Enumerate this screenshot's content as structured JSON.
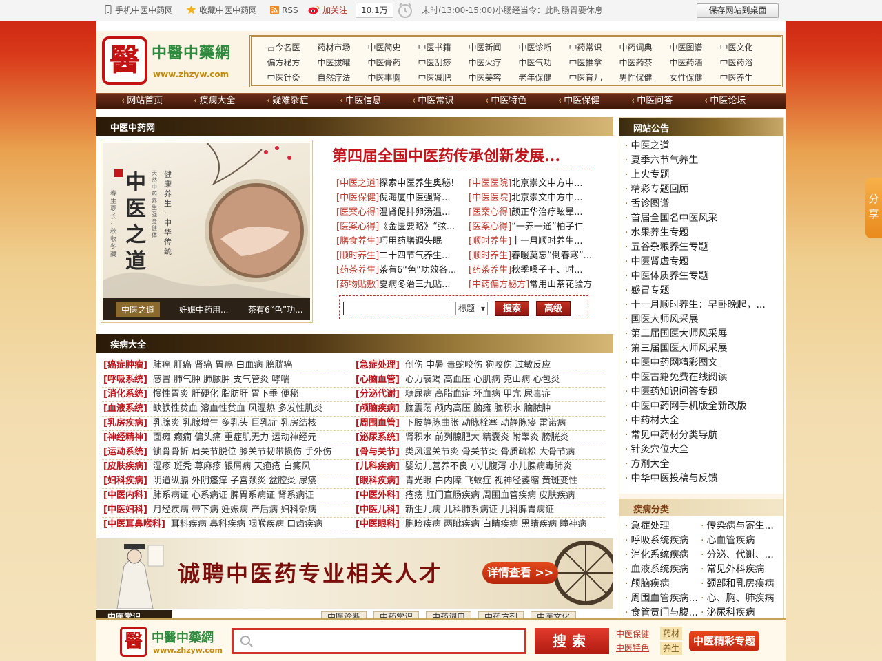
{
  "topbar": {
    "mobile": "手机中医中药网",
    "favorite": "收藏中医中药网",
    "rss": "RSS",
    "follow": "加关注",
    "fans": "10.1万",
    "notice": "未时(13:00-15:00)小肠经当令：此时肠胃要休息",
    "save_desktop": "保存网站到桌面"
  },
  "logo": {
    "seal": "醫",
    "cn": "中醫中藥網",
    "url": "www.zhzyw.com"
  },
  "header_links": [
    "古今名医",
    "药材市场",
    "中医简史",
    "中医书籍",
    "中医新闻",
    "中医诊断",
    "中药常识",
    "中药词典",
    "中医图谱",
    "中医文化",
    "偏方秘方",
    "中医拔罐",
    "中医膏药",
    "中医刮痧",
    "中医火疗",
    "中医气功",
    "中医推拿",
    "中医药茶",
    "中医药酒",
    "中医药浴",
    "中医针灸",
    "自然疗法",
    "中医丰胸",
    "中医减肥",
    "中医美容",
    "老年保健",
    "中医育儿",
    "男性保健",
    "女性保健",
    "中医养生"
  ],
  "nav": [
    "网站首页",
    "疾病大全",
    "疑难杂症",
    "中医信息",
    "中医常识",
    "中医特色",
    "中医保健",
    "中医问答",
    "中医论坛"
  ],
  "sections": {
    "main": "中医中药网",
    "notice": "网站公告",
    "disease": "疾病大全",
    "disease_class": "疾病分类",
    "zy_common": "中医常识"
  },
  "feature": {
    "captions": [
      "中医之道",
      "妊娠中药用...",
      "茶有6“色”功..."
    ],
    "art_title": "中医之道",
    "art_sub1": "健康养生 · 中华传统",
    "art_sub2": "天然中药养生强身健体",
    "art_small": "春生夏长 · 秋收冬藏"
  },
  "headline": "第四届全国中医药传承创新发展...",
  "news": [
    [
      {
        "cat": "[中医之道]",
        "text": "探索中医养生奥秘!"
      },
      {
        "cat": "[中医医院]",
        "text": "北京崇文中方中..."
      }
    ],
    [
      {
        "cat": "[中医保健]",
        "text": "倪海厦中医强肾..."
      },
      {
        "cat": "[中医医院]",
        "text": "北京崇文中方中..."
      }
    ],
    [
      {
        "cat": "[医案心得]",
        "text": "温肾促排卵汤温..."
      },
      {
        "cat": "[医案心得]",
        "text": "颜正华治疗眩晕..."
      }
    ],
    [
      {
        "cat": "[医案心得]",
        "text": "《金匮要略》“弦..."
      },
      {
        "cat": "[医案心得]",
        "text": "“一养一通”柏子仁"
      }
    ],
    [
      {
        "cat": "[膳食养生]",
        "text": "巧用药膳调失眠"
      },
      {
        "cat": "[顺时养生]",
        "text": "十一月顺时养生..."
      }
    ],
    [
      {
        "cat": "[顺时养生]",
        "text": "二十四节气养生..."
      },
      {
        "cat": "[顺时养生]",
        "text": "春暖莫忘“倒春寒”..."
      }
    ],
    [
      {
        "cat": "[药茶养生]",
        "text": "茶有6“色”功效各..."
      },
      {
        "cat": "[药茶养生]",
        "text": "秋季嗓子干、时..."
      }
    ],
    [
      {
        "cat": "[药物贴敷]",
        "text": "夏病冬治三九贴..."
      },
      {
        "cat": "[中药偏方秘方]",
        "text": "常用山茶花验方"
      }
    ]
  ],
  "search": {
    "select": "标题",
    "btn_search": "搜索",
    "btn_adv": "高级"
  },
  "diseases": [
    [
      {
        "cat": "[癌症肿瘤]",
        "items": "肺癌 肝癌 肾癌 胃癌 白血病 膀胱癌"
      },
      {
        "cat": "[急症处理]",
        "items": "创伤 中暑 毒蛇咬伤 狗咬伤 过敏反应"
      }
    ],
    [
      {
        "cat": "[呼吸系统]",
        "items": "感冒 肺气肿 肺脓肿 支气管炎 哮喘"
      },
      {
        "cat": "[心脑血管]",
        "items": "心力衰竭 高血压 心肌病 克山病 心包炎"
      }
    ],
    [
      {
        "cat": "[消化系统]",
        "items": "慢性胃炎 肝硬化 脂肪肝 胃下垂 便秘"
      },
      {
        "cat": "[分泌代谢]",
        "items": "糖尿病 高脂血症 坏血病 甲亢 尿毒症"
      }
    ],
    [
      {
        "cat": "[血液系统]",
        "items": "缺铁性贫血 溶血性贫血 风湿热 多发性肌炎"
      },
      {
        "cat": "[颅脑疾病]",
        "items": "脑震荡 颅内高压 脑瘫 脑积水 脑脓肿"
      }
    ],
    [
      {
        "cat": "[乳房疾病]",
        "items": "乳腺炎 乳腺增生 多乳头 巨乳症 乳房结核"
      },
      {
        "cat": "[周围血管]",
        "items": "下肢静脉曲张 动脉栓塞 动静脉瘘 雷诺病"
      }
    ],
    [
      {
        "cat": "[神经精神]",
        "items": "面瘫 癫痫 偏头痛 重症肌无力 运动神经元"
      },
      {
        "cat": "[泌尿系统]",
        "items": "肾积水 前列腺肥大 精囊炎 附睾炎 膀胱炎"
      }
    ],
    [
      {
        "cat": "[运动系统]",
        "items": "锁骨骨折 肩关节脱位 膝关节韧带损伤 手外伤"
      },
      {
        "cat": "[骨与关节]",
        "items": "类风湿关节炎 骨关节炎 骨质疏松 大骨节病"
      }
    ],
    [
      {
        "cat": "[皮肤疾病]",
        "items": "湿疹 斑秃 荨麻疹 银屑病 天疱疮 白癜风"
      },
      {
        "cat": "[儿科疾病]",
        "items": "婴幼儿营养不良 小儿腹泻 小儿腺病毒肺炎"
      }
    ],
    [
      {
        "cat": "[妇科疾病]",
        "items": "阴道纵膈 外阴瘙痒 子宫颈炎 盆腔炎 尿瘘"
      },
      {
        "cat": "[眼科疾病]",
        "items": "青光眼 白内障 飞蚊症 视神经萎缩 黄斑变性"
      }
    ],
    [
      {
        "cat": "[中医内科]",
        "items": "肺系病证 心系病证 脾胃系病证 肾系病证"
      },
      {
        "cat": "[中医外科]",
        "items": "疮疡 肛门直肠疾病 周围血管疾病 皮肤疾病"
      }
    ],
    [
      {
        "cat": "[中医妇科]",
        "items": "月经疾病 带下病 妊娠病 产后病 妇科杂病"
      },
      {
        "cat": "[中医儿科]",
        "items": "新生儿病 儿科肺系病证 儿科脾胃病证"
      }
    ],
    [
      {
        "cat": "[中医耳鼻喉科]",
        "items": "耳科疾病 鼻科疾病 咽喉疾病 口齿疾病"
      },
      {
        "cat": "[中医眼科]",
        "items": "胞睑疾病 两眦疾病 白睛疾病 黑睛疾病 瞳神病"
      }
    ]
  ],
  "banner": {
    "text": "诚聘中医药专业相关人才",
    "button": "详情查看 >>"
  },
  "zy_tabs": [
    "中医诊断",
    "中药常识",
    "中药词典",
    "中药方剂",
    "中医文化"
  ],
  "notices": [
    "中医之道",
    "夏季六节气养生",
    "上火专题",
    "精彩专题回顾",
    "舌诊图谱",
    "首届全国名中医风采",
    "水果养生专题",
    "五谷杂粮养生专题",
    "中医肾虚专题",
    "中医体质养生专题",
    "感冒专题",
    "十一月顺时养生：早卧晚起，...",
    "国医大师风采展",
    "第二届国医大师风采展",
    "第三届国医大师风采展",
    "中医中药网精彩图文",
    "中医古籍免费在线阅读",
    "中医药知识问答专题",
    "中医中药网手机版全新改版",
    "中药材大全",
    "常见中药材分类导航",
    "针灸穴位大全",
    "方剂大全",
    "中华中医投稿与反馈"
  ],
  "disease_classes": [
    "急症处理",
    "传染病与寄生...",
    "呼吸系统疾病",
    "心血管疾病",
    "消化系统疾病",
    "分泌、代谢、...",
    "血液系统疾病",
    "常见外科疾病",
    "颅脑疾病",
    "颈部和乳房疾病",
    "周围血管疾病...",
    "心、胸、肺疾病",
    "食管贲门与腹...",
    "泌尿科疾病"
  ],
  "share": "分享",
  "bottom": {
    "search_btn": "搜索",
    "links": [
      "中医保健",
      "中医特色"
    ],
    "tags": [
      "药材",
      "养生"
    ],
    "special": "中医精彩专题"
  },
  "colors": {
    "brand_red": "#c0161c",
    "logo_green": "#2e8a3c",
    "nav_brown": "#4a1c0c",
    "accent_gold": "#c48a0c"
  }
}
